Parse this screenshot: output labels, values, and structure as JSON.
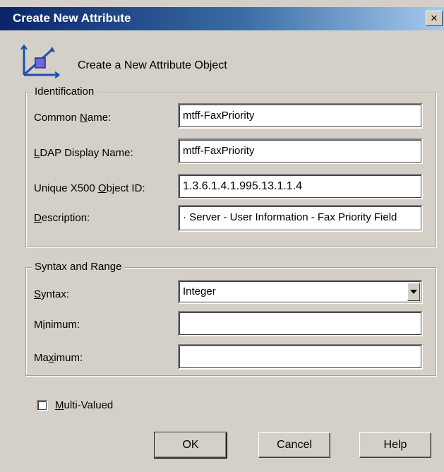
{
  "window": {
    "title": "Create New Attribute",
    "close_symbol": "×"
  },
  "header": {
    "text": "Create a New Attribute Object"
  },
  "identification": {
    "legend": "Identification",
    "common_name": {
      "label_pre": "Common ",
      "label_ul": "N",
      "label_post": "ame:",
      "value": "mtff-FaxPriority"
    },
    "ldap_display_name": {
      "label_pre": "",
      "label_ul": "L",
      "label_post": "DAP Display Name:",
      "value": "mtff-FaxPriority"
    },
    "object_id": {
      "label_pre": "Unique X500 ",
      "label_ul": "O",
      "label_post": "bject ID:",
      "value": "1.3.6.1.4.1.995.13.1.1.4"
    },
    "description": {
      "label_pre": "",
      "label_ul": "D",
      "label_post": "escription:",
      "value": "· Server - User Information - Fax Priority Field"
    }
  },
  "syntax_range": {
    "legend": "Syntax and Range",
    "syntax": {
      "label_pre": "",
      "label_ul": "S",
      "label_post": "yntax:",
      "value": "Integer"
    },
    "minimum": {
      "label_pre": "M",
      "label_ul": "i",
      "label_post": "nimum:",
      "value": ""
    },
    "maximum": {
      "label_pre": "Ma",
      "label_ul": "x",
      "label_post": "imum:",
      "value": ""
    }
  },
  "multi_valued": {
    "label_pre": "",
    "label_ul": "M",
    "label_post": "ulti-Valued",
    "checked": false
  },
  "buttons": {
    "ok": "OK",
    "cancel": "Cancel",
    "help": "Help"
  },
  "colors": {
    "title_start": "#0a246a",
    "title_end": "#a6caf0",
    "face": "#d4d0c8",
    "icon_accent": "#1c4fb0"
  }
}
